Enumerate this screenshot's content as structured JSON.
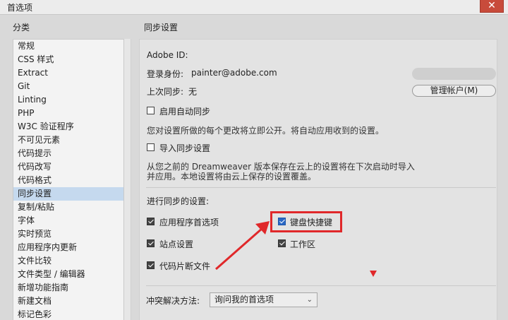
{
  "window": {
    "title": "首选项",
    "close_glyph": "✕"
  },
  "sidebar": {
    "header": "分类",
    "items": [
      "常规",
      "CSS 样式",
      "Extract",
      "Git",
      "Linting",
      "PHP",
      "W3C 验证程序",
      "不可见元素",
      "代码提示",
      "代码改写",
      "代码格式",
      "同步设置",
      "复制/粘贴",
      "字体",
      "实时预览",
      "应用程序内更新",
      "文件比较",
      "文件类型 / 编辑器",
      "新增功能指南",
      "新建文档",
      "标记色彩"
    ],
    "selected_index": 11
  },
  "main": {
    "title": "同步设置",
    "adobe_id_label": "Adobe ID:",
    "login_label": "登录身份:",
    "login_value": "painter@adobe.com",
    "last_sync_label": "上次同步:",
    "last_sync_value": "无",
    "manage_button": "管理帐户(M)",
    "auto_sync_label": "启用自动同步",
    "auto_sync_desc": "您对设置所做的每个更改将立即公开。将自动应用收到的设置。",
    "import_label": "导入同步设置",
    "import_desc_1": "从您之前的 Dreamweaver 版本保存在云上的设置将在下次启动时导入",
    "import_desc_2": "并应用。本地设置将由云上保存的设置覆盖。",
    "sync_settings_label": "进行同步的设置:",
    "options": {
      "app_prefs": "应用程序首选项",
      "keyboard_shortcuts": "键盘快捷键",
      "site_settings": "站点设置",
      "workspace": "工作区",
      "code_snippets": "代码片断文件"
    },
    "conflict_label": "冲突解决方法:",
    "conflict_value": "询问我的首选项"
  },
  "colors": {
    "annotation_red": "#e0282a",
    "selected_row": "#c5d9ee",
    "checkbox_blue": "#2a68c5"
  }
}
